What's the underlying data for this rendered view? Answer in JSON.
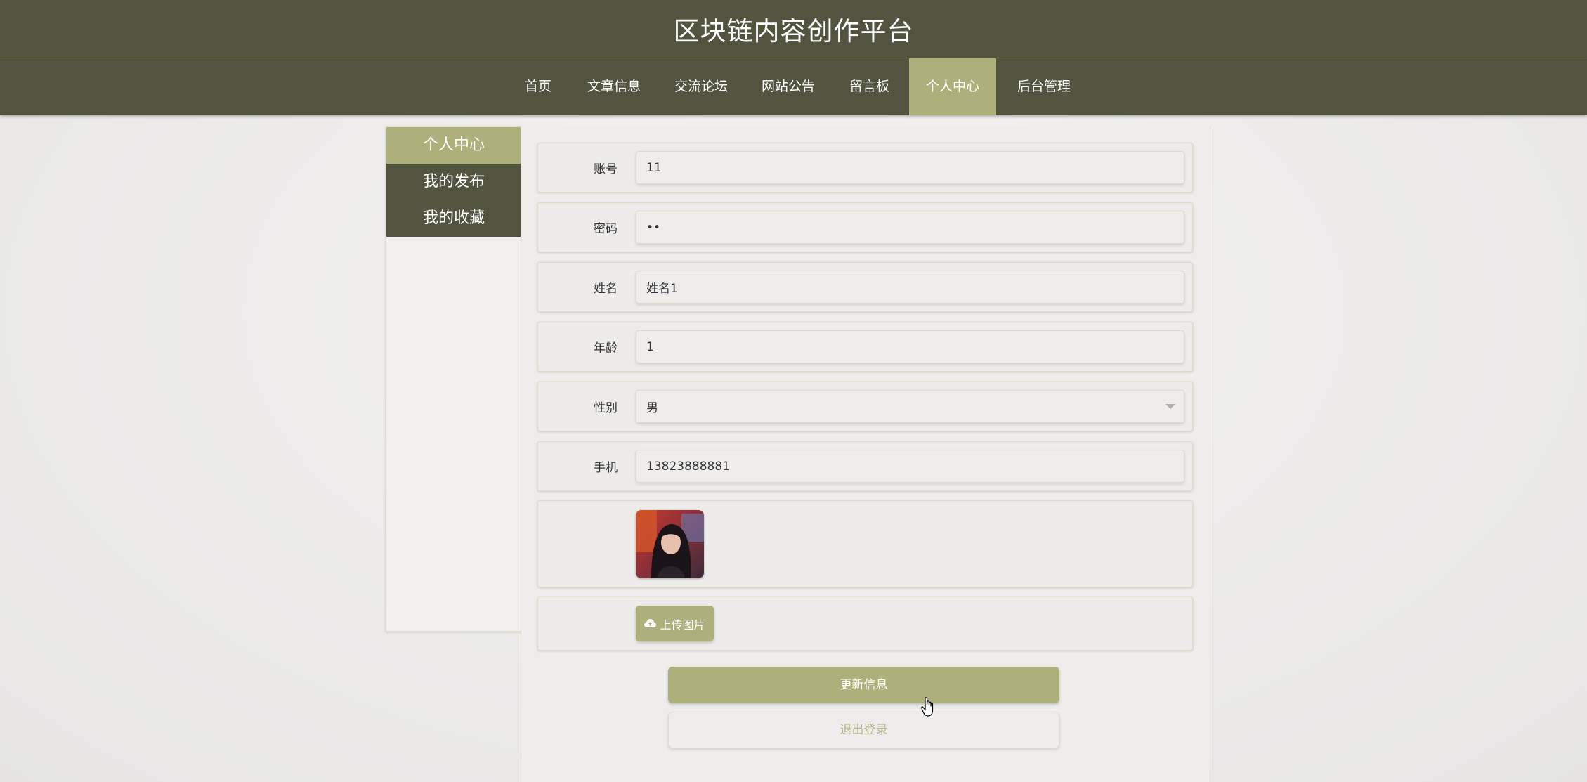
{
  "header": {
    "title": "区块链内容创作平台"
  },
  "nav": {
    "items": [
      {
        "label": "首页"
      },
      {
        "label": "文章信息"
      },
      {
        "label": "交流论坛"
      },
      {
        "label": "网站公告"
      },
      {
        "label": "留言板"
      },
      {
        "label": "个人中心"
      },
      {
        "label": "后台管理"
      }
    ],
    "active": "个人中心"
  },
  "sidebar": {
    "items": [
      {
        "label": "个人中心"
      },
      {
        "label": "我的发布"
      },
      {
        "label": "我的收藏"
      }
    ]
  },
  "form": {
    "account": {
      "label": "账号",
      "value": "11"
    },
    "password": {
      "label": "密码",
      "value": "••"
    },
    "name": {
      "label": "姓名",
      "value": "姓名1"
    },
    "age": {
      "label": "年龄",
      "value": "1"
    },
    "gender": {
      "label": "性别",
      "value": "男"
    },
    "phone": {
      "label": "手机",
      "value": "13823888881"
    },
    "upload_label": "上传图片"
  },
  "actions": {
    "update_label": "更新信息",
    "logout_label": "退出登录"
  },
  "colors": {
    "primary_dark": "#525440",
    "accent": "#adb07a"
  },
  "icons": {
    "upload": "cloud-upload-icon",
    "cursor": "hand-pointer-icon"
  }
}
